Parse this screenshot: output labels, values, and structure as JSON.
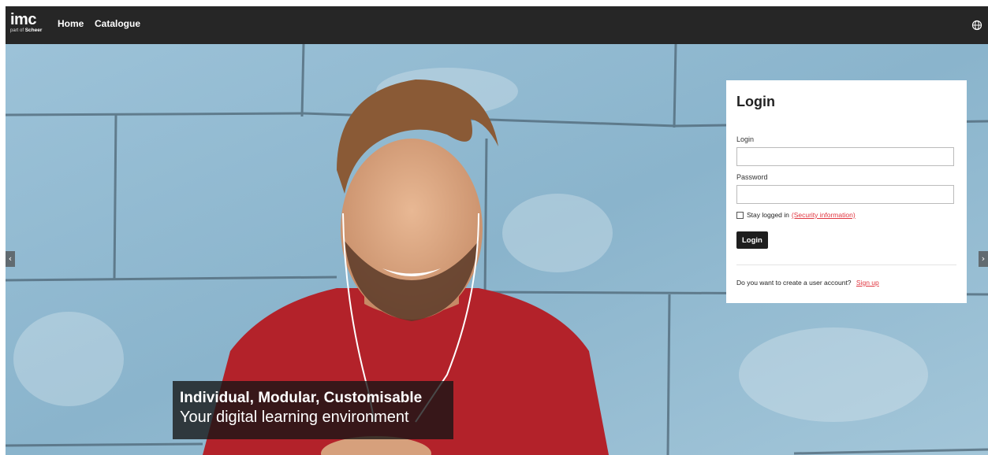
{
  "header": {
    "logo_main": "imc",
    "logo_sub_prefix": "part of",
    "logo_sub_brand": "Scheer",
    "nav": [
      {
        "label": "Home",
        "active": true
      },
      {
        "label": "Catalogue",
        "active": false
      }
    ],
    "language_icon": "globe-icon"
  },
  "hero": {
    "title": "Individual, Modular, Customisable",
    "subtitle": "Your digital learning environment",
    "prev_icon": "‹",
    "next_icon": "›"
  },
  "login": {
    "heading": "Login",
    "login_label": "Login",
    "login_value": "",
    "password_label": "Password",
    "password_value": "",
    "stay_logged_label": "Stay logged in",
    "security_link": "(Security information)",
    "submit_label": "Login",
    "signup_prompt": "Do you want to create a user account?",
    "signup_link": "Sign up"
  },
  "colors": {
    "topbar": "#262626",
    "accent": "#d8303a",
    "link": "#e0353f",
    "button": "#1e1e1e"
  }
}
